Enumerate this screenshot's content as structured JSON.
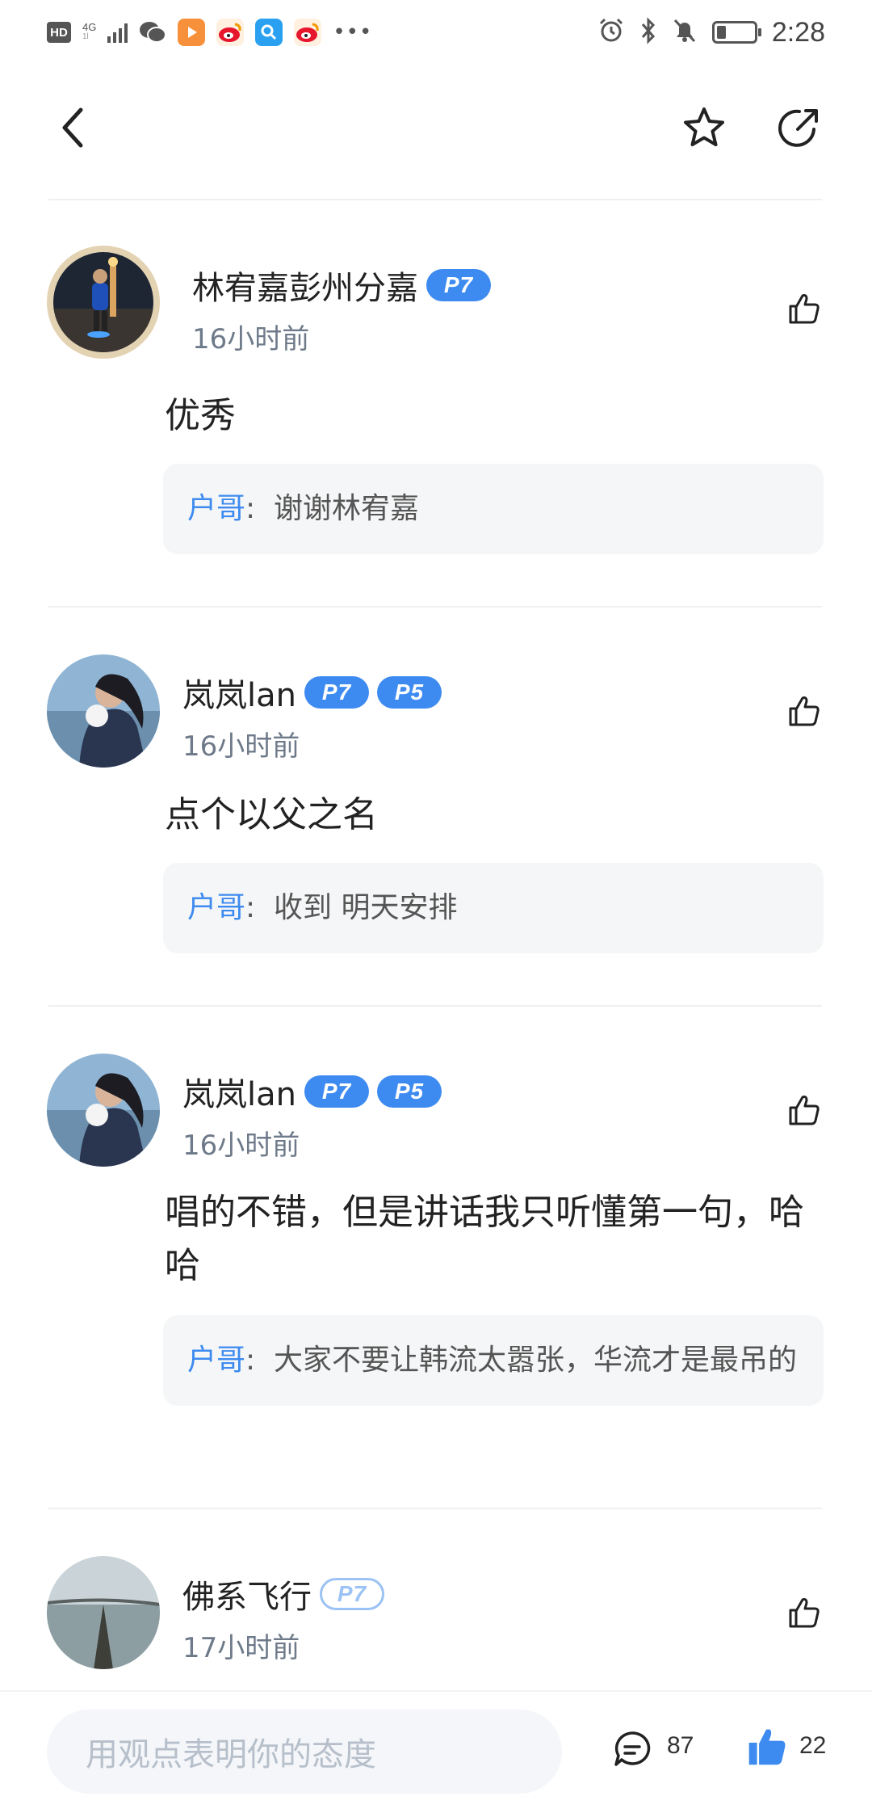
{
  "statusbar": {
    "hd": "HD",
    "network": "4G",
    "time": "2:28",
    "battery_level": 0.25
  },
  "header": {
    "back_icon": "chevron-left-icon",
    "star_icon": "star-outline-icon",
    "share_icon": "share-arrow-icon"
  },
  "comments": [
    {
      "username": "林宥嘉彭州分嘉",
      "badges": [
        "P7"
      ],
      "time": "16小时前",
      "text": "优秀",
      "reply_name": "户哥",
      "reply_sep": ":",
      "reply_text": "谢谢林宥嘉"
    },
    {
      "username": "岚岚lan",
      "badges": [
        "P7",
        "P5"
      ],
      "time": "16小时前",
      "text": "点个以父之名",
      "reply_name": "户哥",
      "reply_sep": ":",
      "reply_text": "收到 明天安排"
    },
    {
      "username": "岚岚lan",
      "badges": [
        "P7",
        "P5"
      ],
      "time": "16小时前",
      "text": "唱的不错，但是讲话我只听懂第一句，哈哈",
      "reply_name": "户哥",
      "reply_sep": ":",
      "reply_text": "大家不要让韩流太嚣张，华流才是最吊的"
    },
    {
      "username": "佛系飞行",
      "badges": [
        "P7"
      ],
      "time": "17小时前"
    }
  ],
  "bottombar": {
    "input_placeholder": "用观点表明你的态度",
    "comment_count": "87",
    "like_count": "22"
  },
  "colors": {
    "accent": "#3d8bf0",
    "muted_text": "#6e7a8a",
    "reply_bg": "#f5f6f7"
  }
}
